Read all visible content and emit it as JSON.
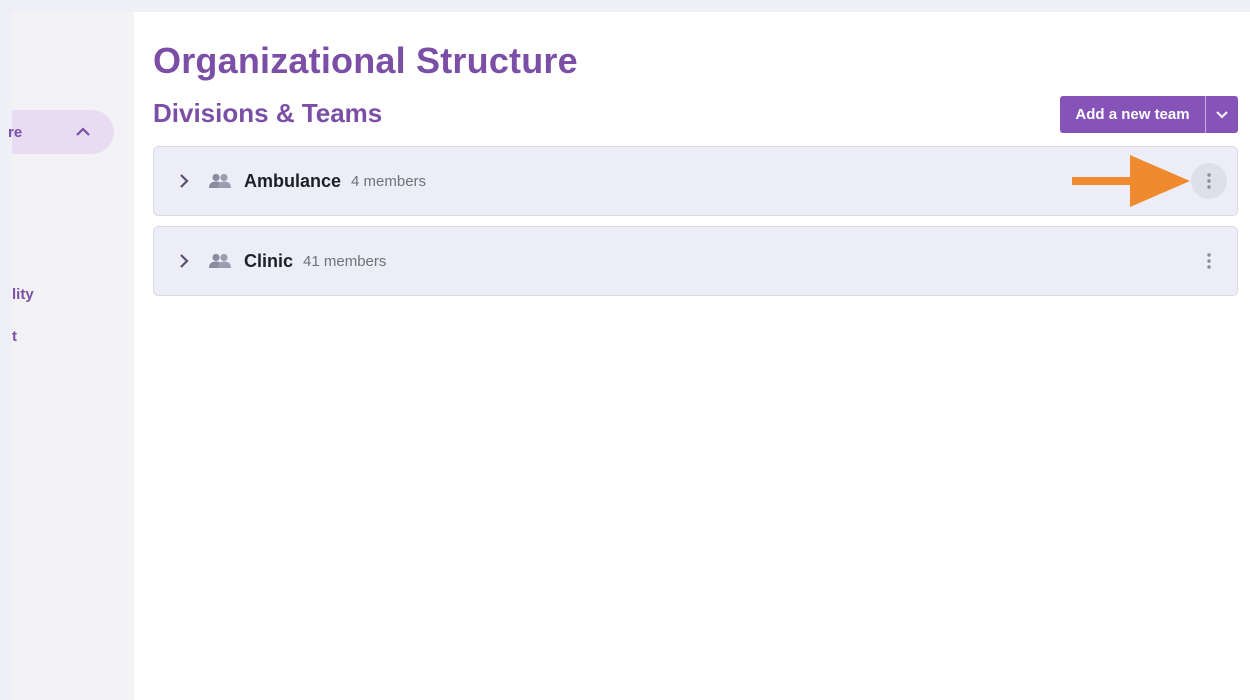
{
  "sidebar": {
    "active_item": {
      "label": "re"
    },
    "items": [
      {
        "label": "lity"
      },
      {
        "label": "t"
      }
    ]
  },
  "header": {
    "title": "Organizational Structure",
    "subtitle": "Divisions & Teams"
  },
  "actions": {
    "add_team_label": "Add a new team"
  },
  "teams": [
    {
      "name": "Ambulance",
      "members": "4 members"
    },
    {
      "name": "Clinic",
      "members": "41 members"
    }
  ],
  "colors": {
    "brand": "#7b4fa6",
    "button": "#8653b8",
    "annotation_arrow": "#ef8a2f"
  },
  "icons": {
    "expand": "chevron-right-icon",
    "group": "group-icon",
    "menu": "more-vertical-icon"
  }
}
